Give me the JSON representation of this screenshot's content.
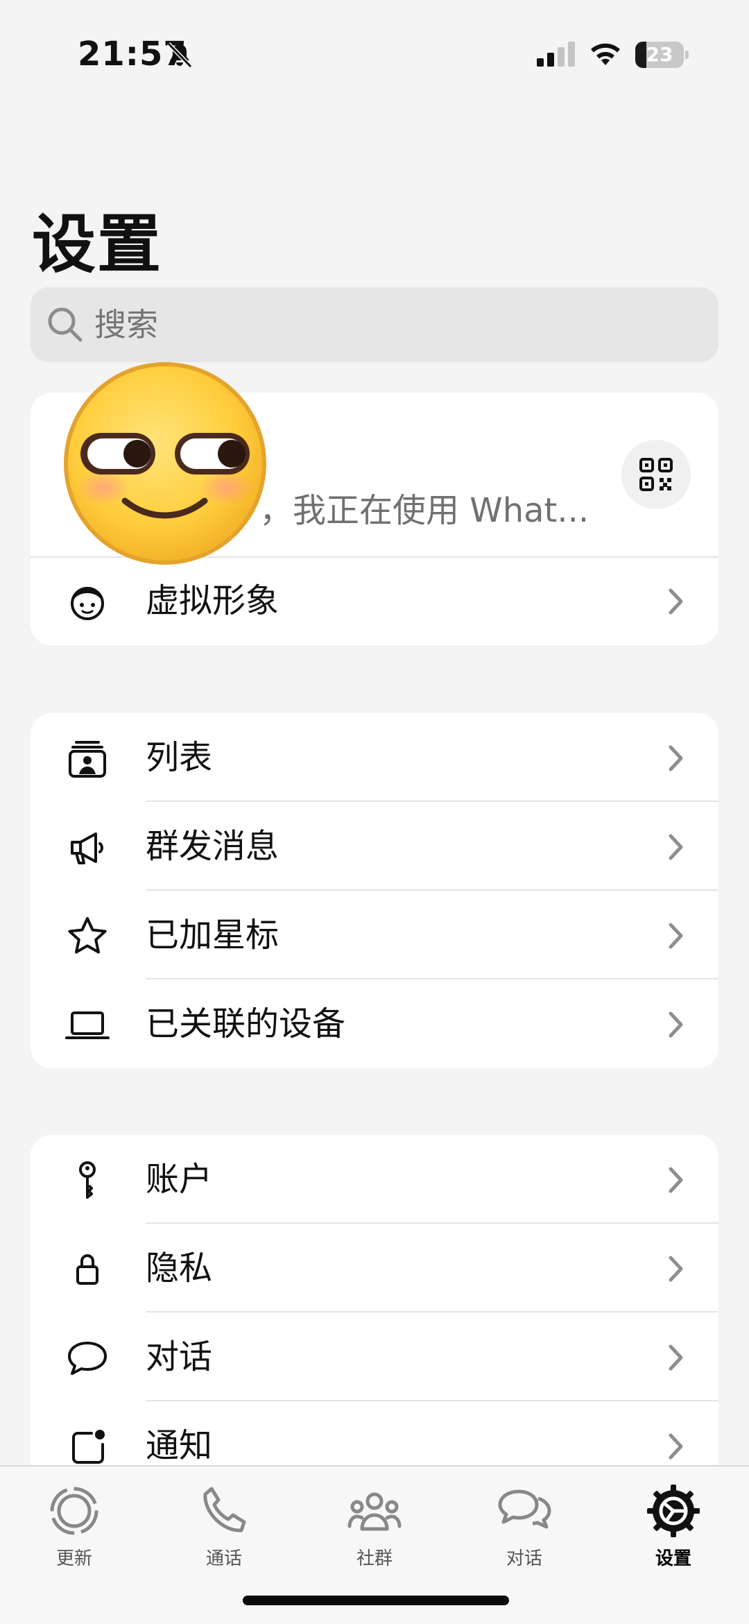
{
  "status_bar": {
    "time": "21:57",
    "battery": "23",
    "battery_fraction": 0.23
  },
  "page_title": "设置",
  "search": {
    "placeholder": "搜索"
  },
  "profile": {
    "status_text": "，我正在使用 What..."
  },
  "profile_rows": [
    {
      "label": "虚拟形象",
      "icon": "avatar-face-icon"
    }
  ],
  "group1": [
    {
      "label": "列表",
      "icon": "lists-icon"
    },
    {
      "label": "群发消息",
      "icon": "megaphone-icon"
    },
    {
      "label": "已加星标",
      "icon": "star-icon"
    },
    {
      "label": "已关联的设备",
      "icon": "laptop-icon"
    }
  ],
  "group2": [
    {
      "label": "账户",
      "icon": "key-icon"
    },
    {
      "label": "隐私",
      "icon": "lock-icon"
    },
    {
      "label": "对话",
      "icon": "chat-bubble-icon"
    },
    {
      "label": "通知",
      "icon": "notification-icon"
    }
  ],
  "tabs": [
    {
      "label": "更新",
      "icon": "updates-icon"
    },
    {
      "label": "通话",
      "icon": "phone-icon"
    },
    {
      "label": "社群",
      "icon": "communities-icon"
    },
    {
      "label": "对话",
      "icon": "chats-icon"
    },
    {
      "label": "设置",
      "icon": "settings-gear-icon",
      "active": true
    }
  ],
  "colors": {
    "background": "#f4f4f4",
    "card": "#ffffff",
    "search_bg": "#e6e6e6",
    "chevron": "#8e8e8e"
  }
}
